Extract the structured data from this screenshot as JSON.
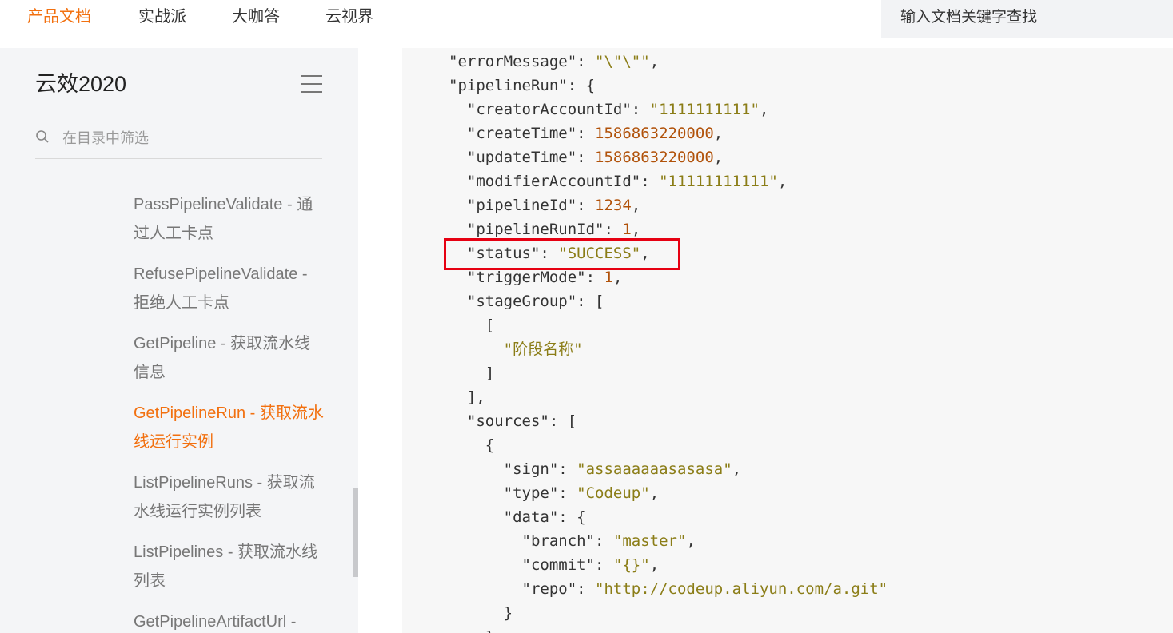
{
  "topnav": {
    "items": [
      "产品文档",
      "实战派",
      "大咖答",
      "云视界"
    ],
    "active_index": 0,
    "search_placeholder": "输入文档关键字查找"
  },
  "sidebar": {
    "title": "云效2020",
    "filter_placeholder": "在目录中筛选",
    "items": [
      {
        "label": "PassPipelineValidate - 通过人工卡点",
        "active": false
      },
      {
        "label": "RefusePipelineValidate - 拒绝人工卡点",
        "active": false
      },
      {
        "label": "GetPipeline - 获取流水线信息",
        "active": false
      },
      {
        "label": "GetPipelineRun - 获取流水线运行实例",
        "active": true
      },
      {
        "label": "ListPipelineRuns - 获取流水线运行实例列表",
        "active": false
      },
      {
        "label": "ListPipelines - 获取流水线列表",
        "active": false
      },
      {
        "label": "GetPipelineArtifactUrl -",
        "active": false
      }
    ]
  },
  "code": {
    "lines": [
      [
        {
          "t": "\"errorMessage\"",
          "c": "k"
        },
        {
          "t": ": ",
          "c": "p"
        },
        {
          "t": "\"\\\"\\\"\"",
          "c": "s"
        },
        {
          "t": ",",
          "c": "p"
        }
      ],
      [
        {
          "t": "\"pipelineRun\"",
          "c": "k"
        },
        {
          "t": ": {",
          "c": "p"
        }
      ],
      [
        {
          "t": "  \"creatorAccountId\"",
          "c": "k"
        },
        {
          "t": ": ",
          "c": "p"
        },
        {
          "t": "\"1111111111\"",
          "c": "s"
        },
        {
          "t": ",",
          "c": "p"
        }
      ],
      [
        {
          "t": "  \"createTime\"",
          "c": "k"
        },
        {
          "t": ": ",
          "c": "p"
        },
        {
          "t": "1586863220000",
          "c": "n"
        },
        {
          "t": ",",
          "c": "p"
        }
      ],
      [
        {
          "t": "  \"updateTime\"",
          "c": "k"
        },
        {
          "t": ": ",
          "c": "p"
        },
        {
          "t": "1586863220000",
          "c": "n"
        },
        {
          "t": ",",
          "c": "p"
        }
      ],
      [
        {
          "t": "  \"modifierAccountId\"",
          "c": "k"
        },
        {
          "t": ": ",
          "c": "p"
        },
        {
          "t": "\"11111111111\"",
          "c": "s"
        },
        {
          "t": ",",
          "c": "p"
        }
      ],
      [
        {
          "t": "  \"pipelineId\"",
          "c": "k"
        },
        {
          "t": ": ",
          "c": "p"
        },
        {
          "t": "1234",
          "c": "n"
        },
        {
          "t": ",",
          "c": "p"
        }
      ],
      [
        {
          "t": "  \"pipelineRunId\"",
          "c": "k"
        },
        {
          "t": ": ",
          "c": "p"
        },
        {
          "t": "1",
          "c": "n"
        },
        {
          "t": ",",
          "c": "p"
        }
      ],
      [
        {
          "t": "  \"status\"",
          "c": "k"
        },
        {
          "t": ": ",
          "c": "p"
        },
        {
          "t": "\"SUCCESS\"",
          "c": "s"
        },
        {
          "t": ",",
          "c": "p"
        }
      ],
      [
        {
          "t": "  \"triggerMode\"",
          "c": "k"
        },
        {
          "t": ": ",
          "c": "p"
        },
        {
          "t": "1",
          "c": "n"
        },
        {
          "t": ",",
          "c": "p"
        }
      ],
      [
        {
          "t": "  \"stageGroup\"",
          "c": "k"
        },
        {
          "t": ": [",
          "c": "p"
        }
      ],
      [
        {
          "t": "    [",
          "c": "p"
        }
      ],
      [
        {
          "t": "      \"阶段名称\"",
          "c": "s"
        }
      ],
      [
        {
          "t": "    ]",
          "c": "p"
        }
      ],
      [
        {
          "t": "  ],",
          "c": "p"
        }
      ],
      [
        {
          "t": "  \"sources\"",
          "c": "k"
        },
        {
          "t": ": [",
          "c": "p"
        }
      ],
      [
        {
          "t": "    {",
          "c": "p"
        }
      ],
      [
        {
          "t": "      \"sign\"",
          "c": "k"
        },
        {
          "t": ": ",
          "c": "p"
        },
        {
          "t": "\"assaaaaaasasasa\"",
          "c": "s"
        },
        {
          "t": ",",
          "c": "p"
        }
      ],
      [
        {
          "t": "      \"type\"",
          "c": "k"
        },
        {
          "t": ": ",
          "c": "p"
        },
        {
          "t": "\"Codeup\"",
          "c": "s"
        },
        {
          "t": ",",
          "c": "p"
        }
      ],
      [
        {
          "t": "      \"data\"",
          "c": "k"
        },
        {
          "t": ": {",
          "c": "p"
        }
      ],
      [
        {
          "t": "        \"branch\"",
          "c": "k"
        },
        {
          "t": ": ",
          "c": "p"
        },
        {
          "t": "\"master\"",
          "c": "s"
        },
        {
          "t": ",",
          "c": "p"
        }
      ],
      [
        {
          "t": "        \"commit\"",
          "c": "k"
        },
        {
          "t": ": ",
          "c": "p"
        },
        {
          "t": "\"{}\"",
          "c": "s"
        },
        {
          "t": ",",
          "c": "p"
        }
      ],
      [
        {
          "t": "        \"repo\"",
          "c": "k"
        },
        {
          "t": ": ",
          "c": "p"
        },
        {
          "t": "\"http://codeup.aliyun.com/a.git\"",
          "c": "s"
        }
      ],
      [
        {
          "t": "      }",
          "c": "p"
        }
      ],
      [
        {
          "t": "    }",
          "c": "p"
        }
      ]
    ]
  },
  "colors": {
    "accent": "#f2700f",
    "highlight_border": "#e60012",
    "string": "#8b7d17",
    "number": "#b1520a"
  }
}
